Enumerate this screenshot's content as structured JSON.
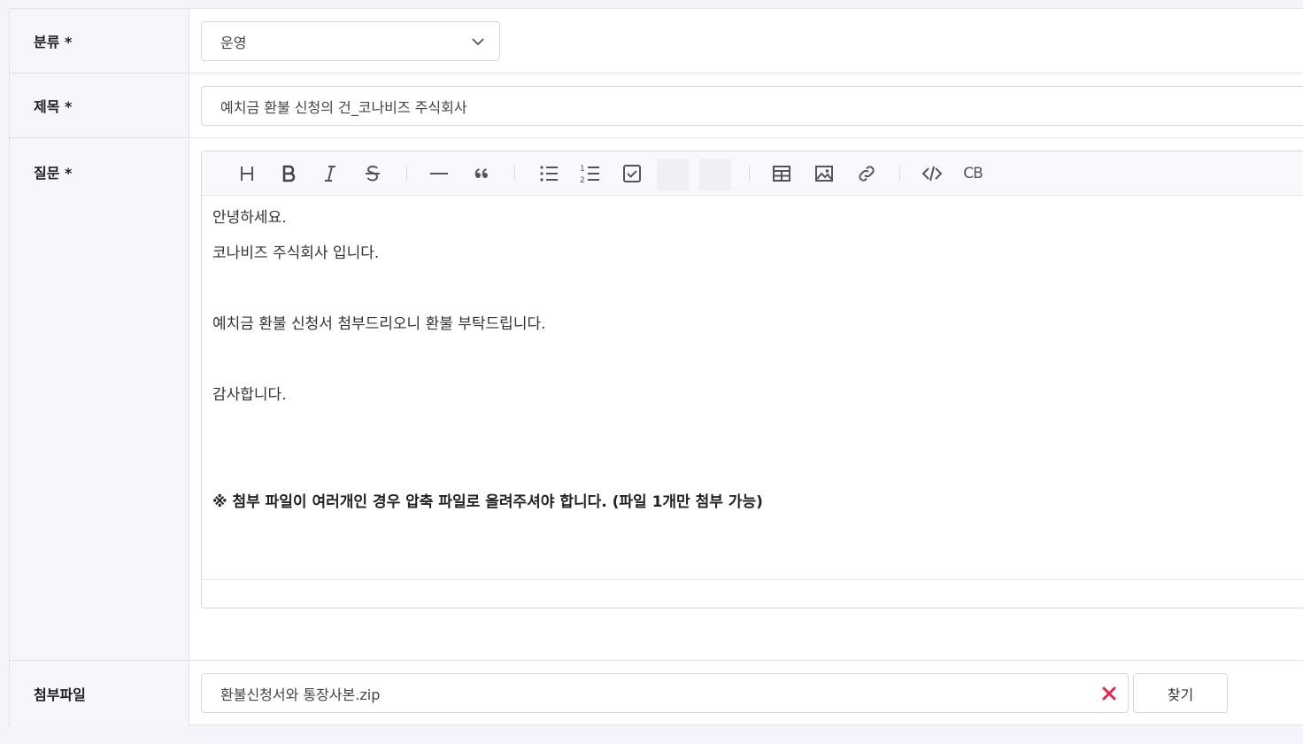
{
  "form": {
    "category": {
      "label": "분류 *",
      "value": "운영"
    },
    "title": {
      "label": "제목 *",
      "value": "예치금 환불 신청의 건_코나비즈 주식회사"
    },
    "question": {
      "label": "질문 *",
      "toolbar": {
        "heading": "H",
        "bold": "B",
        "italic": "I",
        "strike": "S",
        "codeblock": "CB"
      },
      "body_lines": [
        "안녕하세요.",
        "코나비즈 주식회사 입니다.",
        "예치금 환불 신청서 첨부드리오니 환불 부탁드립니다.",
        "감사합니다.",
        "※ 첨부 파일이 여러개인 경우 압축 파일로 올려주셔야 합니다. (파일 1개만 첨부 가능)"
      ]
    },
    "attachment": {
      "label": "첨부파일",
      "value": "환불신청서와 통장사본.zip",
      "find_label": "찾기"
    }
  },
  "colors": {
    "remove_icon": "#e0284f",
    "label_bg": "#f7f7fb",
    "page_bg": "#f4f4fa"
  },
  "icons": [
    "chevron-down-icon",
    "heading-icon",
    "bold-icon",
    "italic-icon",
    "strikethrough-icon",
    "horizontal-rule-icon",
    "quote-icon",
    "bullet-list-icon",
    "ordered-list-icon",
    "task-list-icon",
    "table-icon",
    "image-icon",
    "link-icon",
    "code-icon",
    "remove-icon"
  ]
}
